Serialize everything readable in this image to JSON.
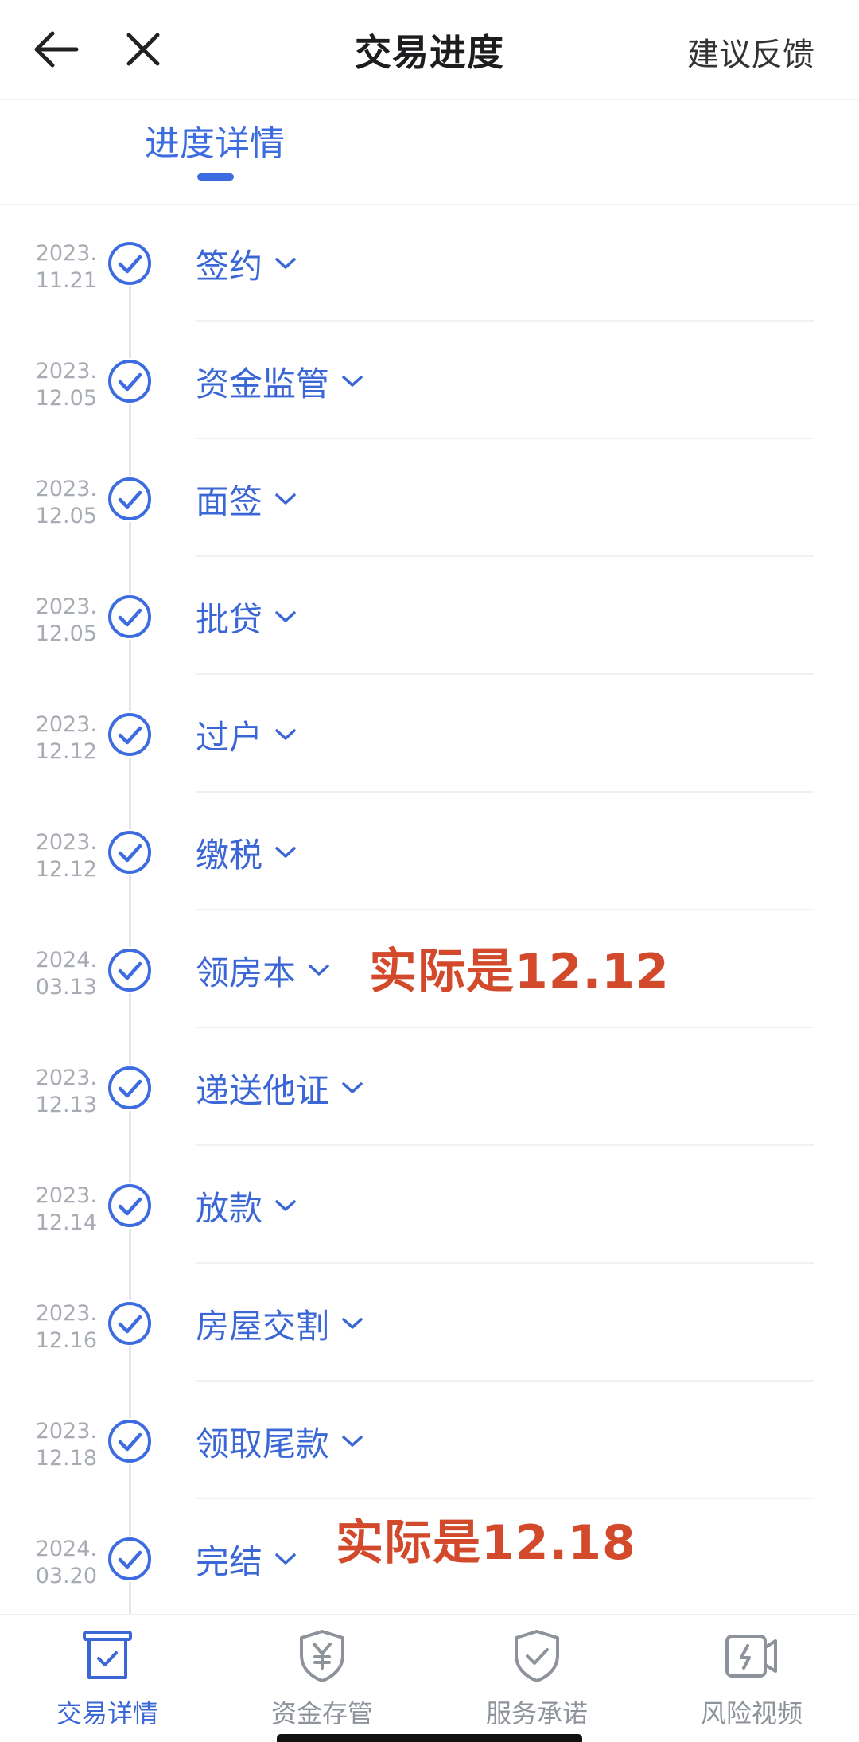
{
  "header": {
    "title": "交易进度",
    "feedback_label": "建议反馈",
    "back_icon": "arrow-left-icon",
    "close_icon": "close-icon"
  },
  "tabs": {
    "active_label": "进度详情"
  },
  "colors": {
    "accent": "#3d6be0",
    "annotation": "#d24a2b",
    "date_gray": "#a7abb3"
  },
  "timeline": {
    "items": [
      {
        "year": "2023.",
        "day": "11.21",
        "label": "签约"
      },
      {
        "year": "2023.",
        "day": "12.05",
        "label": "资金监管"
      },
      {
        "year": "2023.",
        "day": "12.05",
        "label": "面签"
      },
      {
        "year": "2023.",
        "day": "12.05",
        "label": "批贷"
      },
      {
        "year": "2023.",
        "day": "12.12",
        "label": "过户"
      },
      {
        "year": "2023.",
        "day": "12.12",
        "label": "缴税"
      },
      {
        "year": "2024.",
        "day": "03.13",
        "label": "领房本"
      },
      {
        "year": "2023.",
        "day": "12.13",
        "label": "递送他证"
      },
      {
        "year": "2023.",
        "day": "12.14",
        "label": "放款"
      },
      {
        "year": "2023.",
        "day": "12.16",
        "label": "房屋交割"
      },
      {
        "year": "2023.",
        "day": "12.18",
        "label": "领取尾款"
      },
      {
        "year": "2024.",
        "day": "03.20",
        "label": "完结"
      }
    ],
    "annotations": [
      {
        "text": "实际是12.12"
      },
      {
        "text": "实际是12.18"
      }
    ]
  },
  "bottom_nav": {
    "items": [
      {
        "label": "交易详情",
        "icon": "receipt-box-icon"
      },
      {
        "label": "资金存管",
        "icon": "yuan-shield-icon"
      },
      {
        "label": "服务承诺",
        "icon": "check-shield-icon"
      },
      {
        "label": "风险视频",
        "icon": "video-alert-icon"
      }
    ]
  }
}
